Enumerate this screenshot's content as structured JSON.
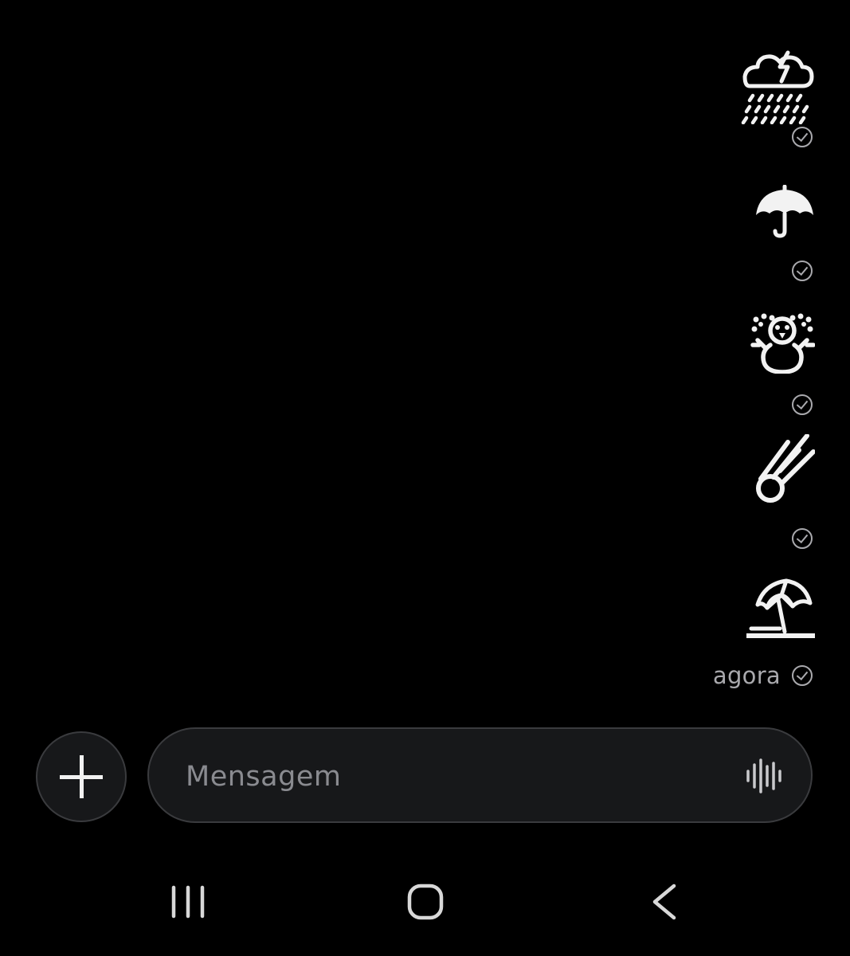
{
  "messages": [
    {
      "icon": "thunderstorm-rain-icon",
      "status": "sent"
    },
    {
      "icon": "umbrella-icon",
      "status": "sent"
    },
    {
      "icon": "snowman-snowflakes-icon",
      "status": "sent"
    },
    {
      "icon": "comet-icon",
      "status": "sent"
    },
    {
      "icon": "beach-umbrella-icon",
      "status": "sent",
      "time": "agora"
    }
  ],
  "composer": {
    "placeholder": "Mensagem",
    "add_icon": "plus-icon",
    "voice_icon": "voice-waveform-icon"
  },
  "navbar": {
    "recents_icon": "recents-icon",
    "home_icon": "home-icon",
    "back_icon": "back-icon"
  },
  "colors": {
    "background": "#000000",
    "surface": "#17181a",
    "border": "#3a3b3e",
    "meta_text": "#a9a9ad",
    "placeholder": "#8a8b90",
    "icon": "#f2f2f2"
  }
}
